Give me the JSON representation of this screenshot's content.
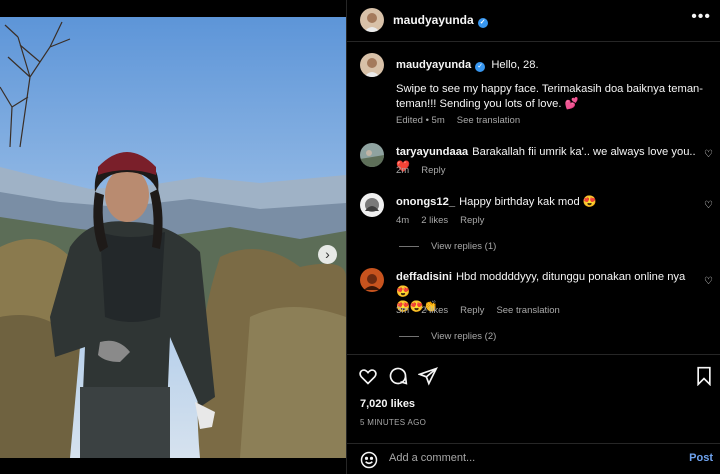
{
  "post": {
    "username": "maudyayunda",
    "caption_title": "Hello, 28.",
    "caption_body": "Swipe to see my happy face. Terimakasih doa baiknya teman-teman!!! Sending you lots of love. 💕",
    "caption_meta": {
      "edited": "Edited • 5m",
      "see_translation": "See translation"
    }
  },
  "comments": [
    {
      "username": "taryayundaaa",
      "text": "Barakallah fii umrik ka'.. we always love you.. ❤️",
      "time": "2m",
      "reply": "Reply"
    },
    {
      "username": "onongs12_",
      "text": "Happy birthday kak mod 😍",
      "time": "4m",
      "likes": "2 likes",
      "reply": "Reply",
      "view_replies": "View replies (1)"
    },
    {
      "username": "deffadisini",
      "text": "Hbd moddddyyy, ditunggu ponakan online nya😍",
      "text2": "😍😍👏",
      "time": "3m",
      "likes": "2 likes",
      "reply": "Reply",
      "see_translation": "See translation",
      "view_replies": "View replies (2)"
    }
  ],
  "stats": {
    "likes": "7,020 likes",
    "ago": "5 MINUTES AGO"
  },
  "composer": {
    "placeholder": "Add a comment...",
    "post": "Post"
  },
  "icons": {
    "more": "more-horizontal-icon",
    "verified": "verified-badge-icon",
    "like": "heart-icon",
    "comment": "comment-icon",
    "share": "share-icon",
    "save": "bookmark-icon",
    "emoji": "emoji-icon",
    "next": "chevron-right-icon"
  },
  "colors": {
    "background": "#000000",
    "link": "#6fa3ef",
    "verified": "#3897f0",
    "secondary_text": "#a8a8a8"
  }
}
